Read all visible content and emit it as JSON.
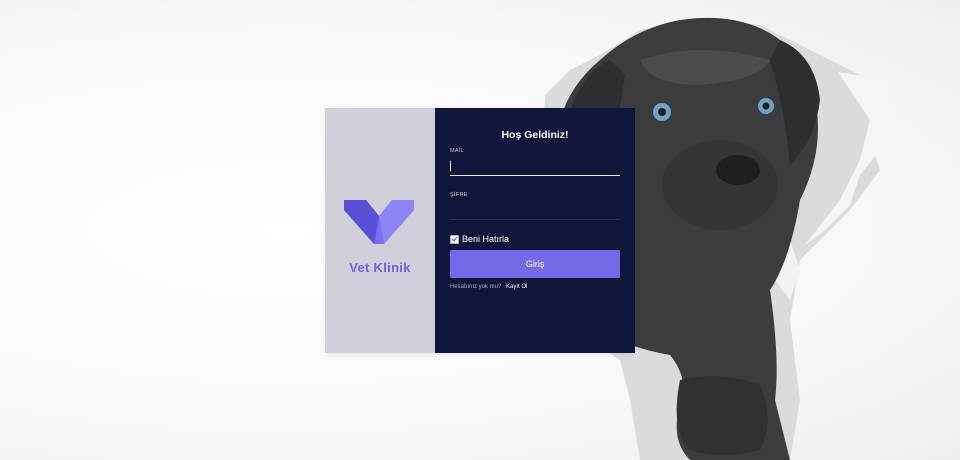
{
  "background": {
    "image": "puppy-tearing-through-paper"
  },
  "brand": {
    "logo_icon": "v-heart-logo-icon",
    "name": "Vet Klinik",
    "color": "#6e62e0"
  },
  "form": {
    "welcome": "Hoş Geldiniz!",
    "mail_label": "MAİL",
    "mail_value": "",
    "password_label": "ŞİFRE",
    "password_value": "",
    "remember_label": "Beni Hatırla",
    "remember_checked": true,
    "login_button": "Giriş",
    "no_account_text": "Hesabınız yok mu?",
    "signup_link": "Kayıt Ol"
  },
  "colors": {
    "form_bg": "#11153a",
    "brand_bg": "#cfd0d9",
    "button": "#7569e8"
  }
}
